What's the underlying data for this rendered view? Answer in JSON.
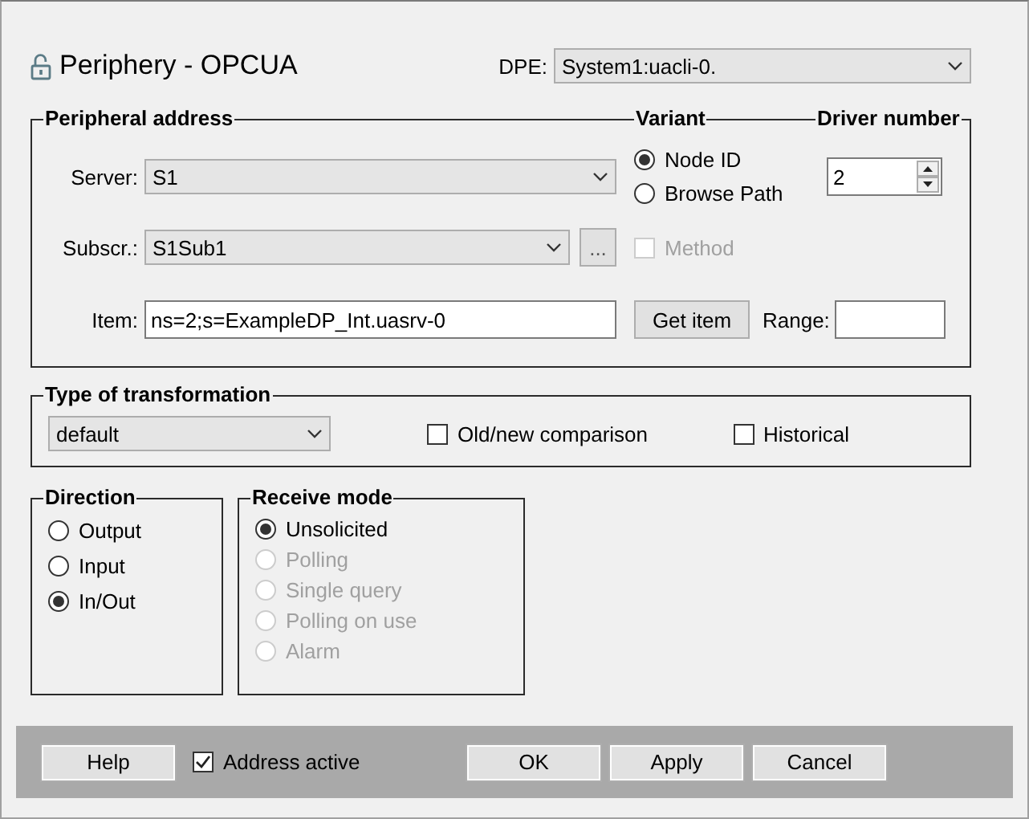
{
  "title": "Periphery - OPCUA",
  "dpe": {
    "label": "DPE:",
    "value": "System1:uacli-0."
  },
  "peripheral_address": {
    "legend": "Peripheral address",
    "variant_legend": "Variant",
    "driver_legend": "Driver number",
    "server": {
      "label": "Server:",
      "value": "S1"
    },
    "subscription": {
      "label": "Subscr.:",
      "value": "S1Sub1",
      "browse_button": "..."
    },
    "variants": [
      {
        "label": "Node ID",
        "selected": true
      },
      {
        "label": "Browse Path",
        "selected": false
      }
    ],
    "driver_number": "2",
    "method": {
      "label": "Method",
      "checked": false,
      "disabled": true
    },
    "item": {
      "label": "Item:",
      "value": "ns=2;s=ExampleDP_Int.uasrv-0"
    },
    "get_item_button": "Get item",
    "range": {
      "label": "Range:"
    }
  },
  "transformation": {
    "legend": "Type of transformation",
    "value": "default",
    "options": [
      {
        "label": "Old/new comparison",
        "checked": false
      },
      {
        "label": "Historical",
        "checked": false
      }
    ]
  },
  "direction": {
    "legend": "Direction",
    "options": [
      {
        "label": "Output",
        "selected": false
      },
      {
        "label": "Input",
        "selected": false
      },
      {
        "label": "In/Out",
        "selected": true
      }
    ]
  },
  "receive_mode": {
    "legend": "Receive mode",
    "options": [
      {
        "label": "Unsolicited",
        "selected": true,
        "disabled": false
      },
      {
        "label": "Polling",
        "selected": false,
        "disabled": true
      },
      {
        "label": "Single query",
        "selected": false,
        "disabled": true
      },
      {
        "label": "Polling on use",
        "selected": false,
        "disabled": true
      },
      {
        "label": "Alarm",
        "selected": false,
        "disabled": true
      }
    ]
  },
  "footer": {
    "help_button": "Help",
    "address_active": {
      "label": "Address active",
      "checked": true
    },
    "buttons": [
      "OK",
      "Apply",
      "Cancel"
    ]
  }
}
